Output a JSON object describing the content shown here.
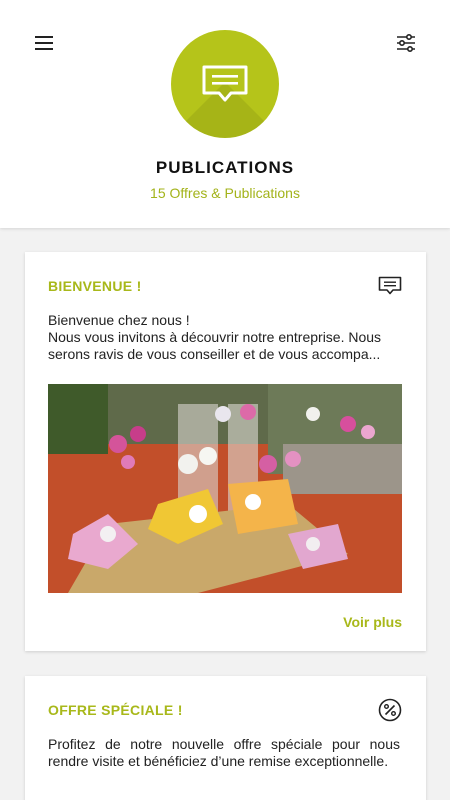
{
  "header": {
    "title": "PUBLICATIONS",
    "subtitle": "15 Offres & Publications",
    "menu_icon": "hamburger-menu-icon",
    "filter_icon": "sliders-filter-icon",
    "hero_icon": "message-icon",
    "accent_color": "#b5c41a"
  },
  "posts": [
    {
      "title": "BIENVENUE !",
      "icon": "message-icon",
      "line1": "Bienvenue chez nous !",
      "line2": "Nous vous invitons à découvrir notre entreprise. Nous serons ravis de vous conseiller et de vous accompa...",
      "photo": "orchids-greenhouse-photo",
      "more_label": "Voir plus"
    },
    {
      "title": "OFFRE SPÉCIALE !",
      "icon": "percent-icon",
      "text": "Profitez de notre nouvelle offre spéciale pour nous rendre visite et bénéficiez d’une remise exceptionnelle."
    }
  ]
}
